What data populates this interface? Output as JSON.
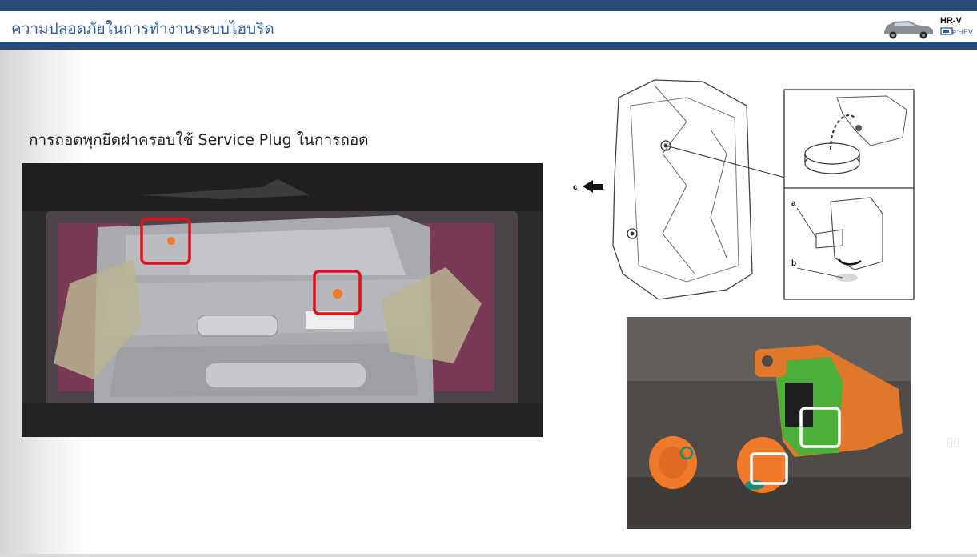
{
  "header": {
    "title": "ความปลอดภัยในการทำงานระบบไฮบริด",
    "logo": {
      "model": "HR-V",
      "badge": "e:HEV"
    }
  },
  "main": {
    "caption": "การถอดพุกยึดฝาครอบใช้ Service Plug ในการถอด",
    "diagram": {
      "label_a": "a",
      "label_b": "b",
      "label_c": "c"
    }
  },
  "colors": {
    "header_bar": "#2a4a78",
    "title_text": "#2f5aa0",
    "highlight_red": "#e0101a",
    "highlight_white": "#ffffff",
    "plug_orange": "#f07a2a",
    "plug_green": "#4caf3a"
  }
}
